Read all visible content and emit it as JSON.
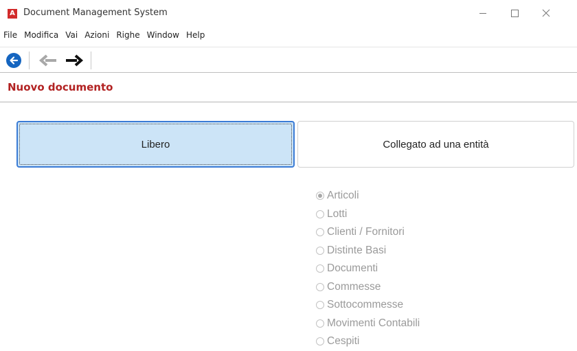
{
  "window": {
    "title": "Document Management System",
    "app_icon_letter": "A",
    "controls": [
      "minimize",
      "maximize",
      "close"
    ]
  },
  "menu": {
    "items": [
      "File",
      "Modifica",
      "Vai",
      "Azioni",
      "Righe",
      "Window",
      "Help"
    ]
  },
  "toolbar": {
    "icons": [
      "back-circle-icon",
      "arrow-left-icon",
      "arrow-right-icon"
    ]
  },
  "page": {
    "heading": "Nuovo documento"
  },
  "mode": {
    "free_label": "Libero",
    "linked_label": "Collegato ad una entità",
    "selected": "free"
  },
  "entities": {
    "selected_index": 0,
    "items": [
      "Articoli",
      "Lotti",
      "Clienti / Fornitori",
      "Distinte Basi",
      "Documenti",
      "Commesse",
      "Sottocommesse",
      "Movimenti Contabili",
      "Cespiti"
    ]
  },
  "colors": {
    "heading": "#b22222",
    "selected_mode_bg": "#cce4f7",
    "selected_mode_border": "#3a7bd5",
    "back_button": "#1565c0"
  }
}
